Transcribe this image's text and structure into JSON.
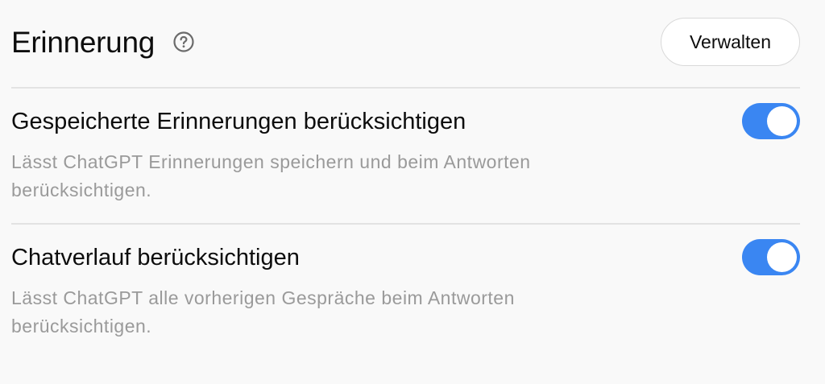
{
  "header": {
    "title": "Erinnerung",
    "help_icon": "question-circle-icon",
    "manage_label": "Verwalten"
  },
  "settings": [
    {
      "title": "Gespeicherte Erinnerungen berücksichtigen",
      "description": "Lässt ChatGPT Erinnerungen speichern und beim Antworten berücksichtigen.",
      "enabled": true
    },
    {
      "title": "Chatverlauf berücksichtigen",
      "description": "Lässt ChatGPT alle vorherigen Gespräche beim Antworten berücksichtigen.",
      "enabled": true
    }
  ],
  "colors": {
    "toggle_on": "#3a86f2",
    "description_text": "#9a9a9a",
    "divider": "#e3e3e3"
  }
}
